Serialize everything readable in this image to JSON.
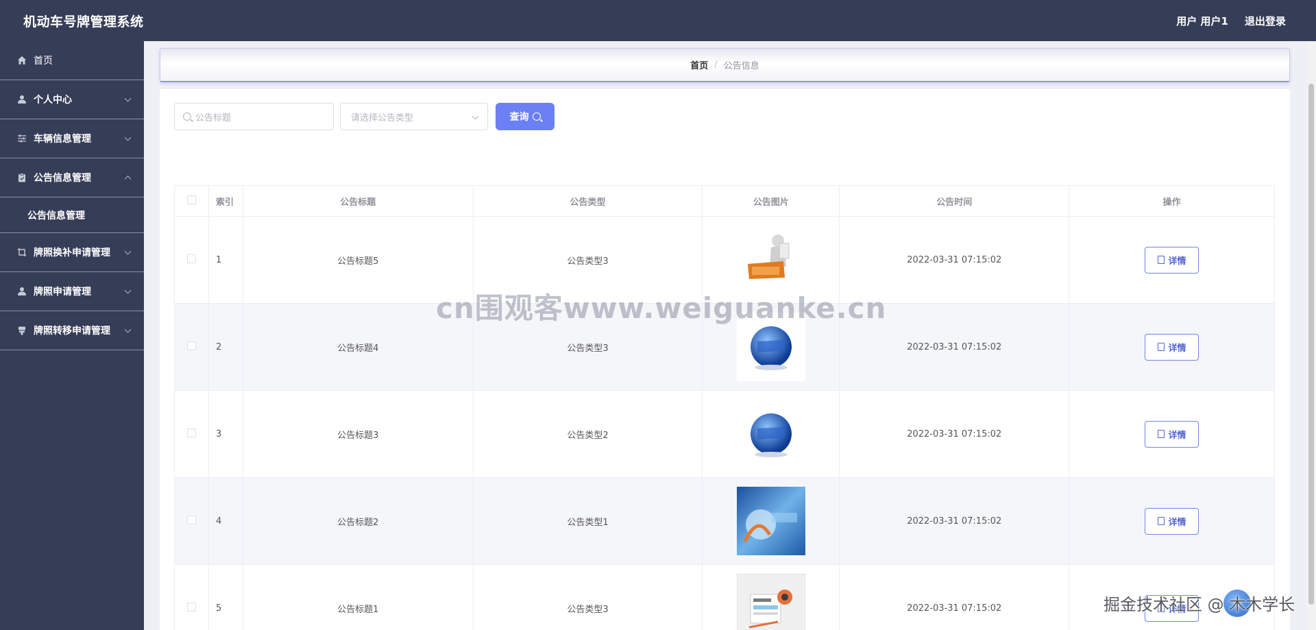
{
  "app": {
    "title": "机动车号牌管理系统"
  },
  "header": {
    "user_label": "用户 用户1",
    "logout": "退出登录"
  },
  "sidebar": {
    "items": [
      {
        "label": "首页",
        "icon": "home-icon"
      },
      {
        "label": "个人中心",
        "icon": "user-icon"
      },
      {
        "label": "车辆信息管理",
        "icon": "sliders-icon"
      },
      {
        "label": "公告信息管理",
        "icon": "clipboard-icon",
        "expanded": true,
        "sub": "公告信息管理"
      },
      {
        "label": "牌照换补申请管理",
        "icon": "crop-icon"
      },
      {
        "label": "牌照申请管理",
        "icon": "user-icon"
      },
      {
        "label": "牌照转移申请管理",
        "icon": "stamp-icon"
      }
    ]
  },
  "breadcrumb": {
    "home": "首页",
    "separator": "/",
    "current": "公告信息"
  },
  "search": {
    "title_placeholder": "公告标题",
    "type_placeholder": "请选择公告类型",
    "query_label": "查询"
  },
  "table": {
    "headers": [
      "索引",
      "公告标题",
      "公告类型",
      "公告图片",
      "公告时间",
      "操作"
    ],
    "rows": [
      {
        "index": "1",
        "title": "公告标题5",
        "type": "公告类型3",
        "image": "news-figure",
        "time": "2022-03-31 07:15:02",
        "action": "详情"
      },
      {
        "index": "2",
        "title": "公告标题4",
        "type": "公告类型3",
        "image": "news-globe",
        "time": "2022-03-31 07:15:02",
        "action": "详情"
      },
      {
        "index": "3",
        "title": "公告标题3",
        "type": "公告类型2",
        "image": "news-globe",
        "time": "2022-03-31 07:15:02",
        "action": "详情"
      },
      {
        "index": "4",
        "title": "公告标题2",
        "type": "公告类型1",
        "image": "news-blue-abstract",
        "time": "2022-03-31 07:15:02",
        "action": "详情"
      },
      {
        "index": "5",
        "title": "公告标题1",
        "type": "公告类型3",
        "image": "news-paper",
        "time": "2022-03-31 07:15:02",
        "action": "详情"
      }
    ]
  },
  "watermarks": {
    "center": "cn围观客www.weiguanke.cn",
    "corner": "掘金技术社区 @ 木木学长"
  },
  "colors": {
    "sidebar_bg": "#363d57",
    "primary": "#6a80f4",
    "detail_border": "#7084e8"
  }
}
